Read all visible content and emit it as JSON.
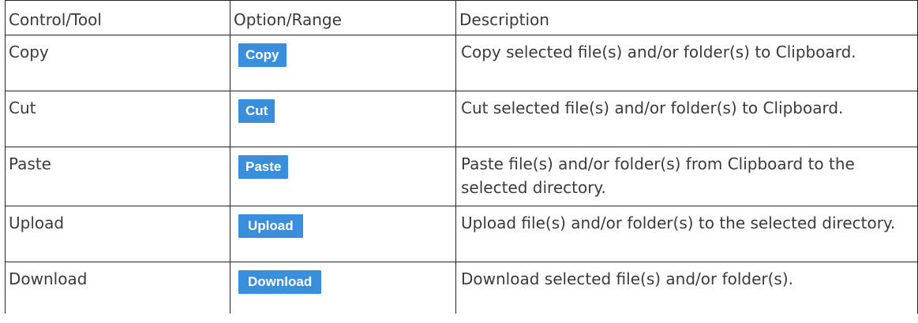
{
  "table": {
    "headers": {
      "control": "Control/Tool",
      "option": "Option/Range",
      "description": "Description"
    },
    "rows": [
      {
        "control": "Copy",
        "button": "Copy",
        "description": "Copy selected file(s) and/or folder(s) to Clipboard."
      },
      {
        "control": "Cut",
        "button": "Cut",
        "description": "Cut selected file(s) and/or folder(s) to Clipboard."
      },
      {
        "control": "Paste",
        "button": "Paste",
        "description": "Paste file(s) and/or folder(s) from Clipboard to the selected directory."
      },
      {
        "control": "Upload",
        "button": "Upload",
        "description": "Upload file(s) and/or folder(s) to the selected directory."
      },
      {
        "control": "Download",
        "button": "Download",
        "description": "Download selected file(s) and/or folder(s)."
      }
    ]
  },
  "colors": {
    "button_bg": "#3a8fdd",
    "button_text": "#ffffff",
    "border": "#222222",
    "text": "#3a3a3a"
  }
}
